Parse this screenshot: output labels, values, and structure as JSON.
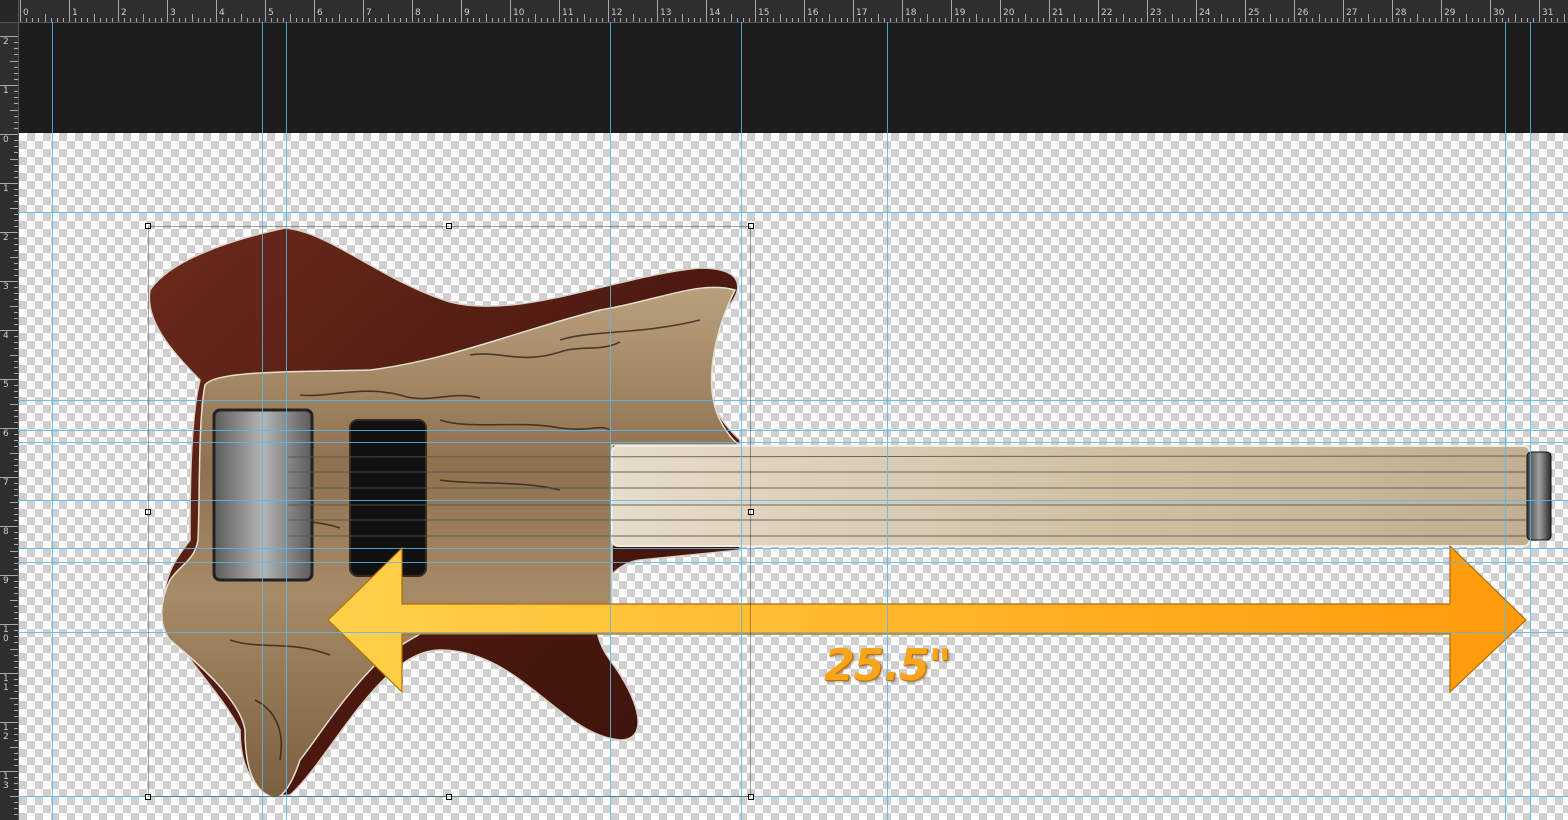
{
  "ruler": {
    "top_labels": [
      "0",
      "1",
      "2",
      "3",
      "4",
      "5",
      "6",
      "7",
      "8",
      "9",
      "10",
      "11",
      "12",
      "13",
      "14",
      "15",
      "16",
      "17",
      "18",
      "19",
      "20",
      "21",
      "22",
      "23",
      "24",
      "25",
      "26",
      "27",
      "28",
      "29",
      "30",
      "31"
    ],
    "left_labels": [
      "2",
      "1",
      "0",
      "1",
      "2",
      "3",
      "4",
      "5",
      "6",
      "7",
      "8",
      "9",
      "1 0",
      "1 1",
      "1 2",
      "1 3"
    ]
  },
  "artwork": {
    "measurement_label": "25.5\"",
    "arrow_colors": {
      "start": "#ffd04a",
      "end": "#ff9a0a"
    },
    "body_dark_wood": "#5a1f14",
    "spalted_maple": "#a68a66",
    "fretboard": "#d8ccb8"
  }
}
